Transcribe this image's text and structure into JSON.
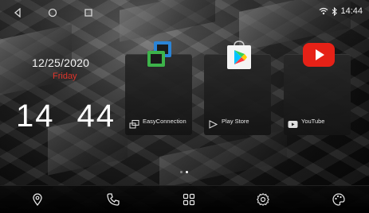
{
  "status_bar": {
    "time": "14:44",
    "icons": [
      "back-icon",
      "home-icon",
      "recent-apps-icon",
      "wifi-icon",
      "bluetooth-icon"
    ]
  },
  "clock_widget": {
    "date": "12/25/2020",
    "day": "Friday",
    "hours": "14",
    "minutes": "44"
  },
  "apps": [
    {
      "label": "EasyConnection",
      "icon": "easyconnection-icon"
    },
    {
      "label": "Play Store",
      "icon": "play-store-icon"
    },
    {
      "label": "YouTube",
      "icon": "youtube-icon"
    }
  ],
  "pager": {
    "pages": 2,
    "current": 2
  },
  "dock": {
    "items": [
      "navigation-icon",
      "phone-icon",
      "app-drawer-icon",
      "settings-icon",
      "theme-icon"
    ]
  },
  "colors": {
    "accent_day": "#e0352b",
    "youtube_red": "#e62117",
    "background": "#0a0a0a"
  }
}
